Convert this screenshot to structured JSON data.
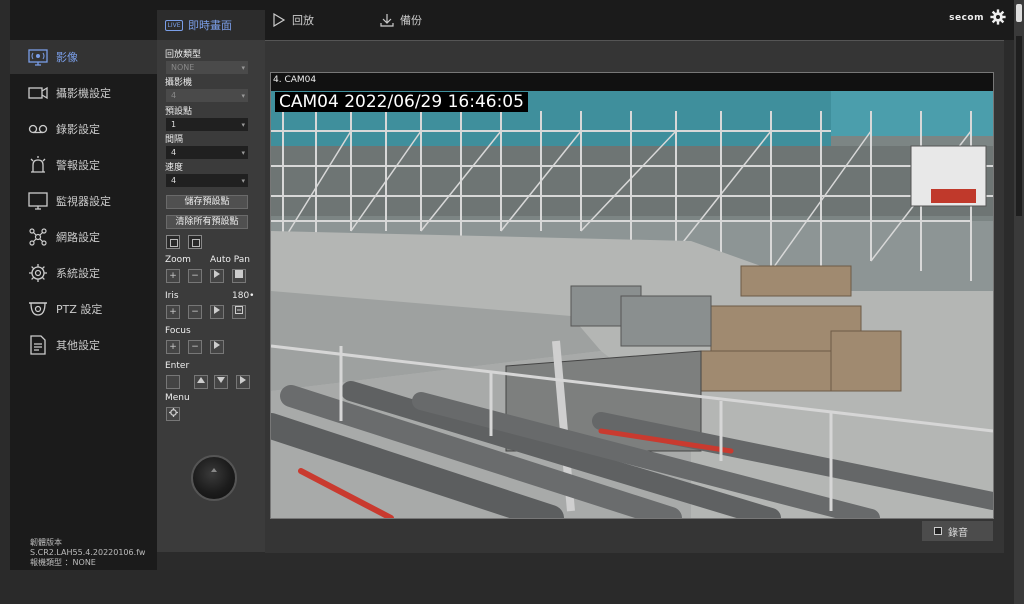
{
  "topbar": {
    "playback_label": "回放",
    "backup_label": "備份",
    "brand": "secom"
  },
  "sidebar": {
    "items": [
      {
        "label": "影像",
        "icon": "monitor-video-icon",
        "active": true
      },
      {
        "label": "攝影機設定",
        "icon": "camera-icon",
        "active": false
      },
      {
        "label": "錄影設定",
        "icon": "tape-icon",
        "active": false
      },
      {
        "label": "警報設定",
        "icon": "alarm-icon",
        "active": false
      },
      {
        "label": "監視器設定",
        "icon": "monitor-icon",
        "active": false
      },
      {
        "label": "網路設定",
        "icon": "network-icon",
        "active": false
      },
      {
        "label": "系統設定",
        "icon": "gear-icon",
        "active": false
      },
      {
        "label": "PTZ 設定",
        "icon": "ptz-camera-icon",
        "active": false
      },
      {
        "label": "其他設定",
        "icon": "document-icon",
        "active": false
      }
    ],
    "firmware_line1": "韌體版本",
    "firmware_line2": "S.CR2.LAH55.4.20220106.fw",
    "firmware_line3": "報機類型 ：NONE"
  },
  "ptz": {
    "header": "即時畫面",
    "live_badge": "LIVE",
    "fields": [
      {
        "label": "回放類型",
        "value": "NONE",
        "disabled": true
      },
      {
        "label": "攝影機",
        "value": "4",
        "disabled": true
      },
      {
        "label": "預設點",
        "value": "1",
        "disabled": false
      },
      {
        "label": "間隔",
        "value": "4",
        "disabled": false
      },
      {
        "label": "速度",
        "value": "4",
        "disabled": false
      }
    ],
    "save_preset": "儲存預設點",
    "clear_presets": "清除所有預設點",
    "zoom_label": "Zoom",
    "autopan_label": "Auto Pan",
    "iris_label": "Iris",
    "deg_label": "180•",
    "focus_label": "Focus",
    "enter_label": "Enter",
    "menu_label": "Menu",
    "plus": "+",
    "minus": "−"
  },
  "video": {
    "cam_label": "4. CAM04",
    "osd": "CAM04 2022/06/29 16:46:05",
    "audio_label": "錄音"
  }
}
